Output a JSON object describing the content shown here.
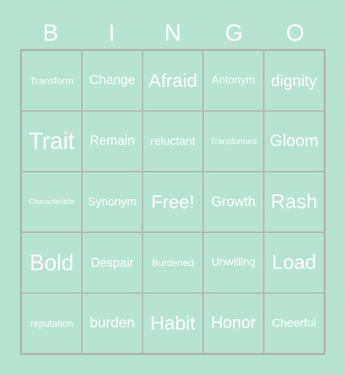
{
  "header": [
    "B",
    "I",
    "N",
    "G",
    "O"
  ],
  "cells": [
    [
      "Transform",
      "Change",
      "Afraid",
      "Antonym",
      "dignity"
    ],
    [
      "Trait",
      "Remain",
      "reluctant",
      "Transformed",
      "Gloom"
    ],
    [
      "Characteristic",
      "Synonym",
      "Free!",
      "Growth",
      "Rash"
    ],
    [
      "Bold",
      "Despair",
      "Burdened",
      "Unwilling",
      "Load"
    ],
    [
      "reputation",
      "burden",
      "Habit",
      "Honor",
      "Cheerful"
    ]
  ]
}
